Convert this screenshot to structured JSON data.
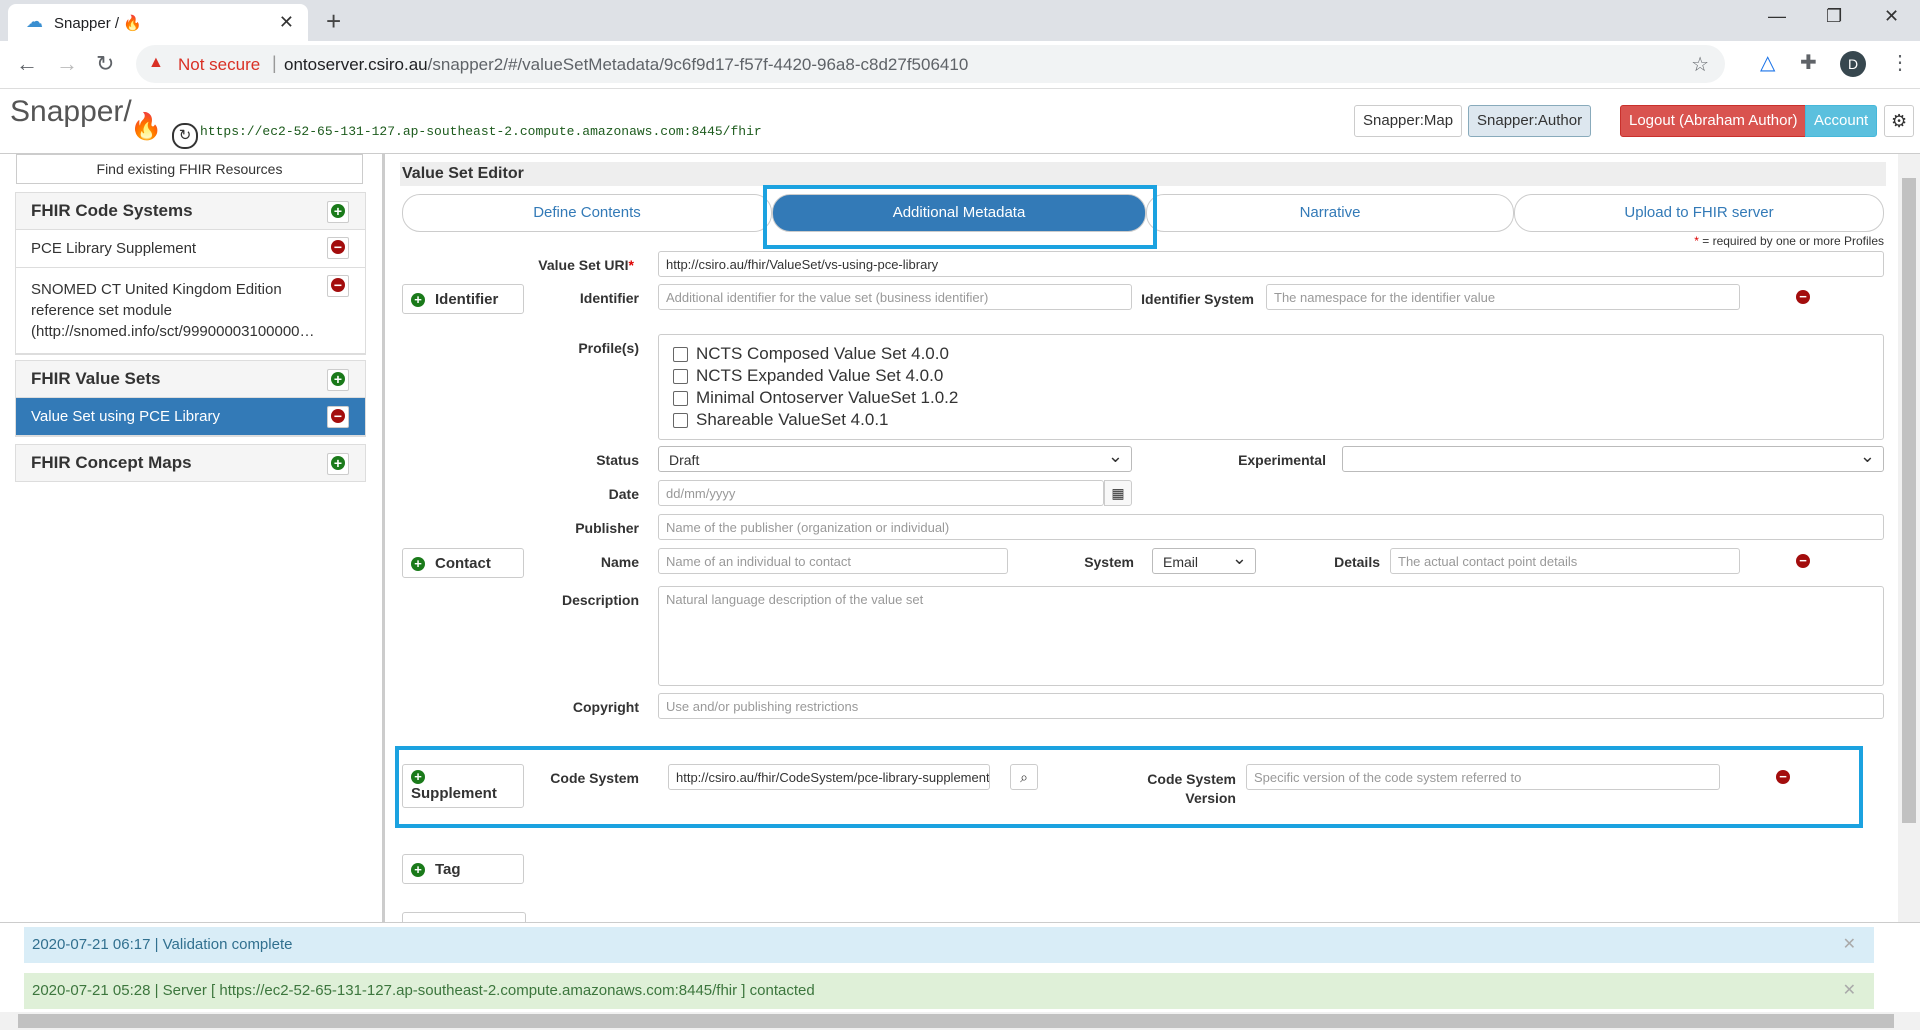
{
  "browser": {
    "tab_title": "Snapper / 🔥",
    "not_secure": "Not secure",
    "url_host": "ontoserver.csiro.au",
    "url_path": "/snapper2/#/valueSetMetadata/9c6f9d17-f57f-4420-96a8-c8d27f506410",
    "avatar_letter": "D"
  },
  "header": {
    "logo": "Snapper/",
    "server_url": "https://ec2-52-65-131-127.ap-southeast-2.compute.amazonaws.com:8445/fhir",
    "snapper_map": "Snapper:Map",
    "snapper_author": "Snapper:Author",
    "logout": "Logout (Abraham Author)",
    "account": "Account"
  },
  "sidebar": {
    "find_button": "Find existing FHIR Resources",
    "code_systems_title": "FHIR Code Systems",
    "code_systems": [
      "PCE Library Supplement",
      "SNOMED CT United Kingdom Edition reference set module (http://snomed.info/sct/99900003100000…"
    ],
    "value_sets_title": "FHIR Value Sets",
    "value_sets": [
      "Value Set using PCE Library"
    ],
    "concept_maps_title": "FHIR Concept Maps"
  },
  "editor": {
    "title": "Value Set Editor",
    "tabs": [
      "Define Contents",
      "Additional Metadata",
      "Narrative",
      "Upload to FHIR server"
    ],
    "required_note": " = required by one or more Profiles",
    "required_star": "*",
    "value_set_uri_label": "Value Set URI",
    "value_set_uri": "http://csiro.au/fhir/ValueSet/vs-using-pce-library",
    "identifier_button": "Identifier",
    "identifier_label": "Identifier",
    "identifier_placeholder": "Additional identifier for the value set (business identifier)",
    "identifier_system_label": "Identifier System",
    "identifier_system_placeholder": "The namespace for the identifier value",
    "profiles_label": "Profile(s)",
    "profiles": [
      "NCTS Composed Value Set 4.0.0",
      "NCTS Expanded Value Set 4.0.0",
      "Minimal Ontoserver ValueSet 1.0.2",
      "Shareable ValueSet 4.0.1"
    ],
    "status_label": "Status",
    "status_value": "Draft",
    "experimental_label": "Experimental",
    "experimental_value": "",
    "date_label": "Date",
    "date_placeholder": "dd/mm/yyyy",
    "publisher_label": "Publisher",
    "publisher_placeholder": "Name of the publisher (organization or individual)",
    "contact_button": "Contact",
    "name_label": "Name",
    "name_placeholder": "Name of an individual to contact",
    "system_label": "System",
    "system_value": "Email",
    "details_label": "Details",
    "details_placeholder": "The actual contact point details",
    "description_label": "Description",
    "description_placeholder": "Natural language description of the value set",
    "copyright_label": "Copyright",
    "copyright_placeholder": "Use and/or publishing restrictions",
    "supplement_button": "Supplement",
    "code_system_label": "Code System",
    "code_system_value": "http://csiro.au/fhir/CodeSystem/pce-library-supplement",
    "code_system_version_label": "Code System Version",
    "code_system_version_placeholder": "Specific version of the code system referred to",
    "tag_button": "Tag"
  },
  "messages": [
    {
      "text": "2020-07-21 06:17 | Validation complete",
      "color": "#d9edf7"
    },
    {
      "text": "2020-07-21 05:28 | Server [ https://ec2-52-65-131-127.ap-southeast-2.compute.amazonaws.com:8445/fhir ] contacted",
      "color": "#dff0d8"
    }
  ],
  "colors": {
    "accent": "#337ab7",
    "highlight": "#1ba2e0",
    "danger": "#d9534f",
    "info": "#5bc0de"
  }
}
